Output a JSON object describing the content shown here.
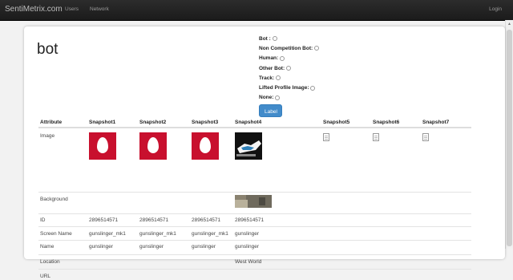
{
  "navbar": {
    "brand": "SentiMetrix.com",
    "links": [
      "Users",
      "Network"
    ],
    "login": "Login"
  },
  "page": {
    "title": "bot"
  },
  "radio_options": [
    "Bot :",
    "Non Competition Bot:",
    "Human:",
    "Other Bot:",
    "Track:",
    "Lifted Profile Image:",
    "None:"
  ],
  "label_button": "Label",
  "table": {
    "headers": [
      "Attribute",
      "Snapshot1",
      "Snapshot2",
      "Snapshot3",
      "Snapshot4",
      "Snapshot5",
      "Snapshot6",
      "Snapshot7"
    ],
    "rows": [
      {
        "attribute": "Image"
      },
      {
        "attribute": "Background"
      },
      {
        "attribute": "ID",
        "values": [
          "2896514571",
          "2896514571",
          "2896514571",
          "2896514571",
          "",
          "",
          ""
        ]
      },
      {
        "attribute": "Screen Name",
        "values": [
          "gunslinger_mk1",
          "gunslinger_mk1",
          "gunslinger_mk1",
          "gunslinger",
          "",
          "",
          ""
        ]
      },
      {
        "attribute": "Name",
        "values": [
          "gunslinger",
          "gunslinger",
          "gunslinger",
          "gunslinger",
          "",
          "",
          ""
        ]
      },
      {
        "attribute": "Location",
        "values": [
          "",
          "",
          "",
          "West World",
          "",
          "",
          ""
        ]
      },
      {
        "attribute": "URL"
      }
    ]
  },
  "colors": {
    "navbar": "#1b1b1b",
    "egg_background": "#c8102e",
    "button": "#428bca"
  }
}
